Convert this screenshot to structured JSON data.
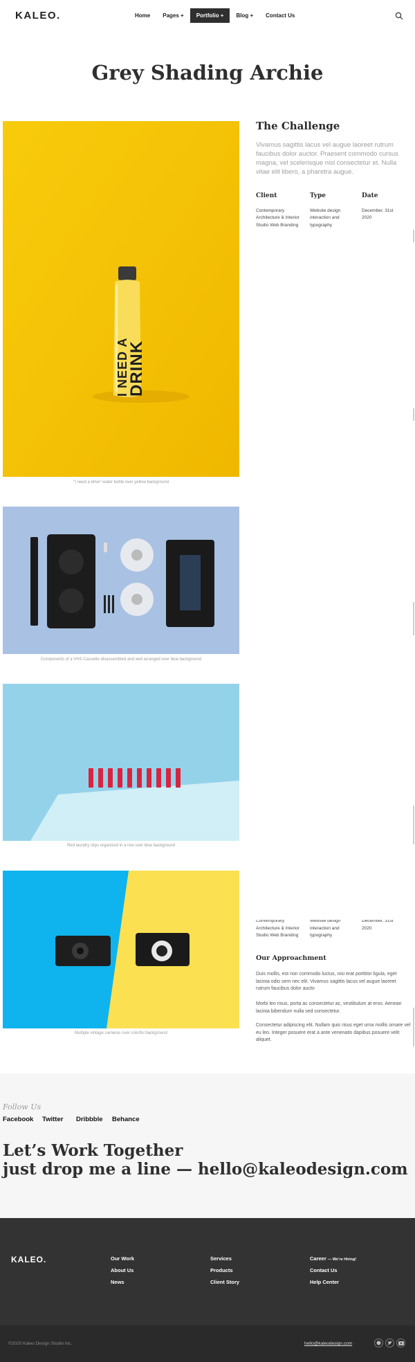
{
  "header": {
    "logo": "KALEO.",
    "nav": [
      "Home",
      "Pages +",
      "Portfolio +",
      "Blog +",
      "Contact Us"
    ],
    "active_nav": "Portfolio +"
  },
  "page_title": "Grey Shading Archie",
  "images": [
    {
      "caption": "\"I need a drive\" water bottle over yellow background",
      "bottle_text_1": "I NEED A",
      "bottle_text_2": "DRINK"
    },
    {
      "caption": "Components of a VHS Cassette disassembled and well arranged over blue background"
    },
    {
      "caption": "Red laundry clips organized in a row over blue background"
    },
    {
      "caption": "Multiple vintage cameras over colorful background"
    }
  ],
  "challenge": {
    "title": "The Challenge",
    "text": "Vivamus sagittis lacus vel augue laoreet rutrum faucibus dolor auctor. Praesent commodo cursus magna, vel scelerisque nisl consectetur et. Nulla vitae elit libero, a pharetra augue."
  },
  "meta": {
    "client_label": "Client",
    "client_value": "Contemporary Architecture & Interior Studio Web Branding",
    "type_label": "Type",
    "type_value": "Website design interaction and typography",
    "date_label": "Date",
    "date_value": "December, 31st 2020"
  },
  "approach": {
    "title": "Our Approachment",
    "p1": "Duis mollis, est non commodo luctus, nisi erat porttitor ligula, eget lacinia odio sem nec elit. Vivamus sagittis lacus vel augue laoreet rutrum faucibus dolor aucto",
    "p2": "Morbi leo risus, porta ac consectetur ac, vestibulum at eros. Aenean lacinia bibendum nulla sed consectetur.",
    "p3": "Consectetur adipiscing elit. Nullam quis risus eget urna mollis ornare vel eu leo. Integer posuere erat a ante venenatis dapibus posuere velit aliquet."
  },
  "follow": {
    "label": "Follow Us",
    "links": [
      "Facebook",
      "Twitter",
      "Dribbble",
      "Behance"
    ],
    "cta_line1": "Let’s Work Together",
    "cta_line2": "just drop me a line —  hello@kaleodesign.com"
  },
  "footer": {
    "logo": "KALEO.",
    "col1": [
      "Our Work",
      "About Us",
      "News"
    ],
    "col2": [
      "Services",
      "Products",
      "Client Story"
    ],
    "col3_career": "Career",
    "col3_hiring": "— We’re Hiring!",
    "col3": [
      "Contact Us",
      "Help Center"
    ],
    "copyright": "©2020 Kaleo Design Studio Inc.",
    "email": "hello@kaleodesign.com",
    "social_icons": [
      "facebook-icon",
      "twitter-icon",
      "youtube-icon"
    ]
  },
  "colors": {
    "yellow": "#f6c400",
    "blue_light": "#a9c0e2",
    "sky": "#8ed0e8",
    "cyan": "#0fb4ee",
    "footer": "#333333"
  }
}
